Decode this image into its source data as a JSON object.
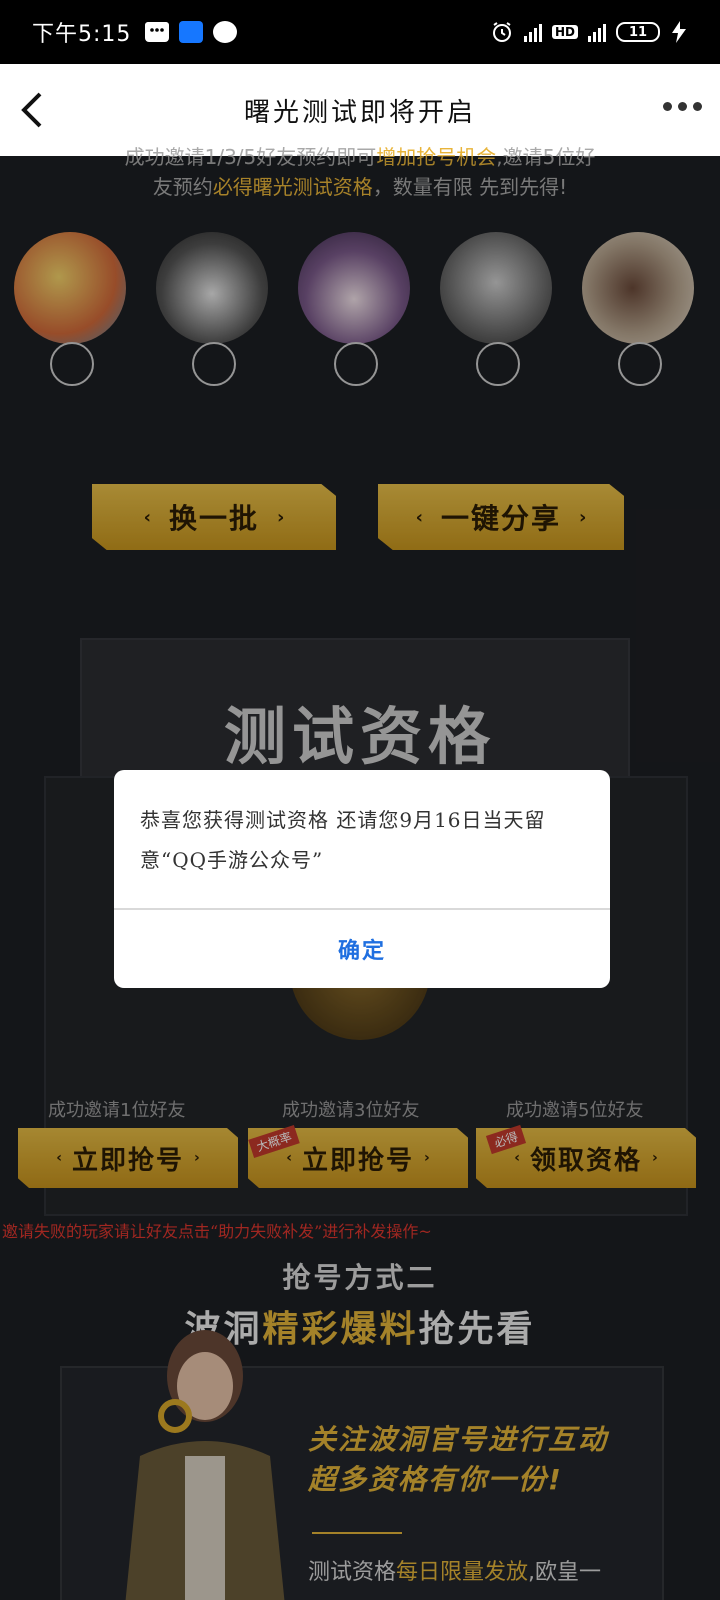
{
  "status_bar": {
    "time": "下午5:15",
    "battery": "11",
    "network_small_1": "4G",
    "network_small_2": "4G",
    "hd": "HD"
  },
  "nav": {
    "title": "曙光测试即将开启"
  },
  "invite_text": {
    "line1_a": "成功邀请1/3/5好友预约即可",
    "line1_hl": "增加抢号机会",
    "line1_b": ",邀请5位好",
    "line2_a": "友预约",
    "line2_hl": "必得曙光测试资格",
    "line2_b": "，数量有限 先到先得!"
  },
  "buttons": {
    "refresh": "换一批",
    "share": "一键分享",
    "arrow_left": "‹",
    "arrow_right": "›"
  },
  "envelope": {
    "title": "测试资格"
  },
  "rewards": [
    {
      "caption": "成功邀请1位好友",
      "button": "立即抢号",
      "badge": ""
    },
    {
      "caption": "成功邀请3位好友",
      "button": "立即抢号",
      "badge": "大概率"
    },
    {
      "caption": "成功邀请5位好友",
      "button": "领取资格",
      "badge": "必得"
    }
  ],
  "note": "邀请失败的玩家请让好友点击“助力失败补发”进行补发操作~",
  "section2": {
    "subtitle": "抢号方式二",
    "title_a": "波洞",
    "title_hl": "精彩爆料",
    "title_b": "抢先看"
  },
  "promo": {
    "line1": "关注波洞官号进行互动",
    "line2": "超多资格有你一份!",
    "body_a": "测试资格",
    "body_hl": "每日限量发放",
    "body_b": ",欧皇一"
  },
  "modal": {
    "message": "恭喜您获得测试资格 还请您9月16日当天留意“QQ手游公众号”",
    "confirm": "确定"
  },
  "colors": {
    "accent_gold": "#e3b43a",
    "link_blue": "#1f6fe0",
    "note_red": "#e0362e"
  }
}
